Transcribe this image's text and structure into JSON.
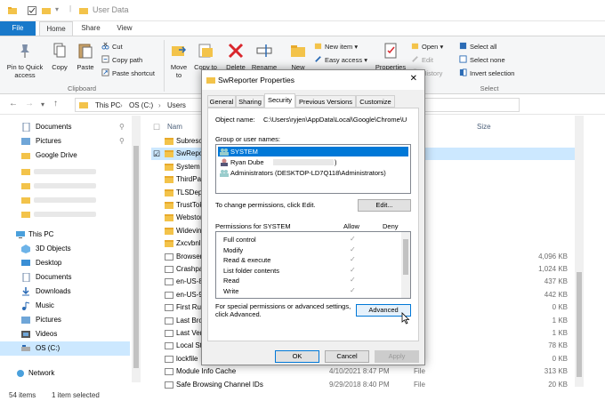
{
  "window": {
    "title": "User Data"
  },
  "ribbon": {
    "tabs": [
      "File",
      "Home",
      "Share",
      "View"
    ],
    "buttons": {
      "pin": "Pin to Quick access",
      "copy": "Copy",
      "paste": "Paste",
      "cut": "Cut",
      "copy_path": "Copy path",
      "paste_shortcut": "Paste shortcut",
      "move_to": "Move to",
      "copy_to": "Copy to",
      "delete": "Delete",
      "rename": "Rename",
      "new": "New",
      "new_item": "New item",
      "easy_access": "Easy access",
      "properties": "Properties",
      "open": "Open",
      "edit": "Edit",
      "history": "History",
      "select_all": "Select all",
      "select_none": "Select none",
      "invert_selection": "Invert selection"
    },
    "groups": {
      "clipboard": "Clipboard",
      "select": "Select"
    }
  },
  "address": {
    "crumbs": [
      "This PC",
      "OS (C:)",
      "Users"
    ]
  },
  "nav": {
    "quick": [
      {
        "label": "Documents"
      },
      {
        "label": "Pictures"
      },
      {
        "label": "Google Drive"
      }
    ],
    "this_pc": "This PC",
    "pc_items": [
      "3D Objects",
      "Desktop",
      "Documents",
      "Downloads",
      "Music",
      "Pictures",
      "Videos",
      "OS (C:)"
    ],
    "network": "Network"
  },
  "filelist": {
    "headers": {
      "name": "Nam",
      "size": "Size"
    },
    "rows": [
      {
        "name": "Subreso",
        "date": "",
        "type": "der",
        "size": "",
        "kind": "folder"
      },
      {
        "name": "SwRepo",
        "date": "",
        "type": "der",
        "size": "",
        "kind": "folder",
        "selected": true
      },
      {
        "name": "System",
        "date": "",
        "type": "der",
        "size": "",
        "kind": "folder"
      },
      {
        "name": "ThirdPa",
        "date": "",
        "type": "der",
        "size": "",
        "kind": "folder"
      },
      {
        "name": "TLSDep",
        "date": "",
        "type": "der",
        "size": "",
        "kind": "folder"
      },
      {
        "name": "TrustTok",
        "date": "",
        "type": "der",
        "size": "",
        "kind": "folder"
      },
      {
        "name": "Webstor",
        "date": "",
        "type": "der",
        "size": "",
        "kind": "folder"
      },
      {
        "name": "Widevin",
        "date": "",
        "type": "der",
        "size": "",
        "kind": "folder"
      },
      {
        "name": "Zxcvbnl",
        "date": "",
        "type": "der",
        "size": "",
        "kind": "folder"
      },
      {
        "name": "Browser",
        "date": "",
        "type": "",
        "size": "4,096 KB",
        "kind": "doc"
      },
      {
        "name": "Crashpa",
        "date": "",
        "type": "",
        "size": "1,024 KB",
        "kind": "doc"
      },
      {
        "name": "en-US-8",
        "date": "",
        "type": "",
        "size": "437 KB",
        "kind": "doc"
      },
      {
        "name": "en-US-9",
        "date": "",
        "type": "",
        "size": "442 KB",
        "kind": "doc"
      },
      {
        "name": "First Ru",
        "date": "",
        "type": "",
        "size": "0 KB",
        "kind": "doc"
      },
      {
        "name": "Last Bro",
        "date": "",
        "type": "",
        "size": "1 KB",
        "kind": "doc"
      },
      {
        "name": "Last Ver",
        "date": "",
        "type": "",
        "size": "1 KB",
        "kind": "doc"
      },
      {
        "name": "Local St",
        "date": "",
        "type": "",
        "size": "78 KB",
        "kind": "doc"
      },
      {
        "name": "lockfile",
        "date": "",
        "type": "",
        "size": "0 KB",
        "kind": "doc"
      },
      {
        "name": "Module Info Cache",
        "date": "4/10/2021 8:47 PM",
        "type": "File",
        "size": "313 KB",
        "kind": "doc"
      },
      {
        "name": "Safe Browsing Channel IDs",
        "date": "9/29/2018 8:40 PM",
        "type": "File",
        "size": "20 KB",
        "kind": "doc"
      }
    ]
  },
  "status": {
    "count": "54 items",
    "selected": "1 item selected"
  },
  "dialog": {
    "title": "SwReporter Properties",
    "tabs": [
      "General",
      "Sharing",
      "Security",
      "Previous Versions",
      "Customize"
    ],
    "object_label": "Object name:",
    "object_value": "C:\\Users\\ryjen\\AppData\\Local\\Google\\Chrome\\U",
    "group_label": "Group or user names:",
    "users": [
      "SYSTEM",
      "Ryan Dube",
      "Administrators (DESKTOP-LD7Q118\\Administrators)"
    ],
    "change_text": "To change permissions, click Edit.",
    "edit_button": "Edit...",
    "perm_label": "Permissions for SYSTEM",
    "allow": "Allow",
    "deny": "Deny",
    "permissions": [
      "Full control",
      "Modify",
      "Read & execute",
      "List folder contents",
      "Read",
      "Write"
    ],
    "special_text_1": "For special permissions or advanced settings,",
    "special_text_2": "click Advanced.",
    "advanced_button": "Advanced",
    "ok": "OK",
    "cancel": "Cancel",
    "apply": "Apply"
  }
}
